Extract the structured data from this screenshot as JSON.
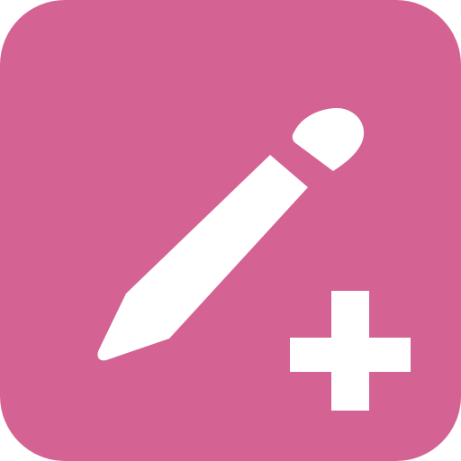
{
  "icon": {
    "name": "add-note-app-icon",
    "background_color": "#D46394",
    "foreground_color": "#FFFFFF",
    "glyphs": [
      "pencil-icon",
      "plus-icon"
    ]
  }
}
